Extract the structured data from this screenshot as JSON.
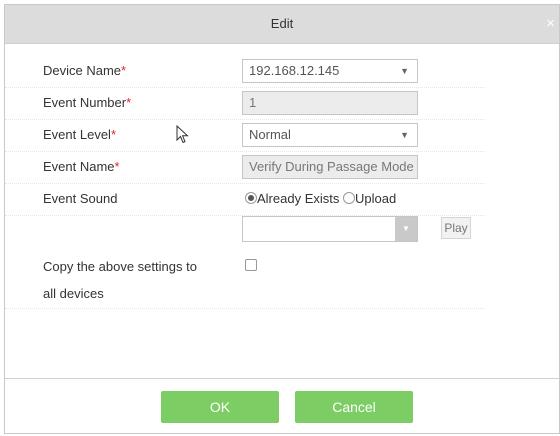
{
  "dialog": {
    "title": "Edit",
    "close_glyph": "×"
  },
  "form": {
    "device_name": {
      "label": "Device Name",
      "required_mark": "*",
      "value": "192.168.12.145"
    },
    "event_number": {
      "label": "Event Number",
      "required_mark": "*",
      "value": "1"
    },
    "event_level": {
      "label": "Event Level",
      "required_mark": "*",
      "value": "Normal"
    },
    "event_name": {
      "label": "Event Name",
      "required_mark": "*",
      "value": "Verify During Passage Mode"
    },
    "event_sound": {
      "label": "Event Sound",
      "options": [
        "Already Exists",
        "Upload"
      ],
      "selected": "Already Exists",
      "file_value": "",
      "play_label": "Play"
    },
    "copy_settings": {
      "label_line1": "Copy the above settings to",
      "label_line2": "all devices",
      "checked": false
    }
  },
  "footer": {
    "ok_label": "OK",
    "cancel_label": "Cancel"
  },
  "colors": {
    "titlebar_bg": "#dcdcdc",
    "required": "#e5202e",
    "button_green": "#7ccd63"
  },
  "icons": {
    "dropdown": "chevron-down-icon",
    "close": "close-icon",
    "cursor": "mouse-pointer-icon"
  }
}
